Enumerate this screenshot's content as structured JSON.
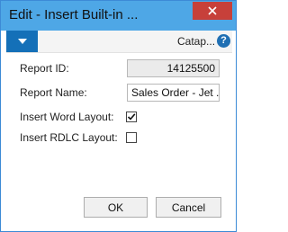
{
  "window": {
    "title": "Edit - Insert Built-in ..."
  },
  "commandbar": {
    "menu_icon": "chevron-down-icon",
    "company": "Catap...",
    "help_icon": "help-icon",
    "help_glyph": "?"
  },
  "form": {
    "report_id_label": "Report ID:",
    "report_id_value": "14125500",
    "report_name_label": "Report Name:",
    "report_name_value": "Sales Order - Jet ...",
    "insert_word_label": "Insert Word Layout:",
    "insert_word_checked": true,
    "insert_rdlc_label": "Insert RDLC Layout:",
    "insert_rdlc_checked": false
  },
  "buttons": {
    "ok": "OK",
    "cancel": "Cancel"
  },
  "colors": {
    "titlebar": "#4ea7e6",
    "close": "#c7403a",
    "accent": "#1470b8"
  }
}
